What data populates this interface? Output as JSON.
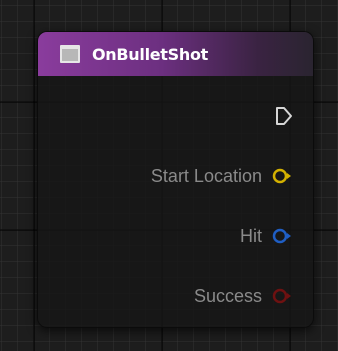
{
  "node": {
    "title": "OnBulletShot",
    "title_icon": "function-icon"
  },
  "pins": [
    {
      "label": "",
      "type": "exec",
      "icon": "exec-pin-icon",
      "color": "#d6d6d6"
    },
    {
      "label": "Start Location",
      "type": "vector",
      "icon": "vector-pin-icon",
      "color": "#d4b100"
    },
    {
      "label": "Hit",
      "type": "struct",
      "icon": "hit-pin-icon",
      "color": "#1f5ec4"
    },
    {
      "label": "Success",
      "type": "boolean",
      "icon": "boolean-pin-icon",
      "color": "#6e1111"
    }
  ]
}
